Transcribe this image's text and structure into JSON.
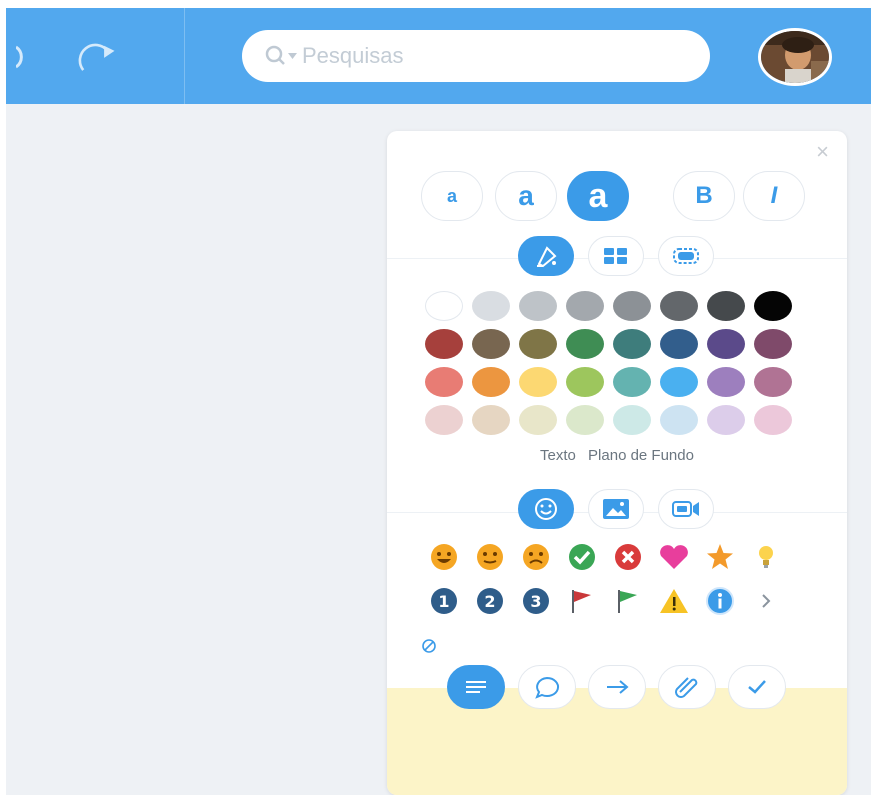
{
  "toolbar": {
    "undo_icon": "undo-icon",
    "redo_icon": "redo-icon",
    "search_placeholder": "Pesquisas",
    "avatar_icon": "avatar"
  },
  "panel": {
    "close_label": "×",
    "font_buttons": [
      {
        "label": "a",
        "name": "font-size-small-button"
      },
      {
        "label": "a",
        "name": "font-size-medium-button"
      },
      {
        "label": "a",
        "name": "font-size-large-button",
        "active": true
      },
      {
        "label": "B",
        "name": "bold-button"
      },
      {
        "label": "I",
        "name": "italic-button"
      }
    ],
    "color_tabs": [
      "fill-icon",
      "layout-icon",
      "border-icon"
    ],
    "colors": [
      [
        "#ffffff",
        "#d9dde2",
        "#bec3c8",
        "#a3a8ad",
        "#8c9196",
        "#63676b",
        "#45494c",
        "#050505"
      ],
      [
        "#a6403c",
        "#786650",
        "#7f7547",
        "#3f8d54",
        "#3e7d7c",
        "#325e8c",
        "#5b4a8a",
        "#7f4a6a"
      ],
      [
        "#e87c74",
        "#ec9640",
        "#fcd872",
        "#9dc65d",
        "#64b3b0",
        "#4ab0f0",
        "#9d7fbe",
        "#b07394"
      ],
      [
        "#ecd1d1",
        "#e6d6c2",
        "#e8e6c9",
        "#dbe8cb",
        "#cde9e7",
        "#cde3f2",
        "#dccdea",
        "#ecc8da"
      ]
    ],
    "color_labels": {
      "text": "Texto",
      "background": "Plano de Fundo"
    },
    "icon_tabs": [
      "smiley-icon",
      "image-icon",
      "video-icon"
    ],
    "icon_rows": [
      [
        "smiley-happy-icon",
        "smiley-neutral-icon",
        "smiley-sad-icon",
        "check-icon",
        "cross-icon",
        "heart-icon",
        "star-icon",
        "bulb-icon"
      ],
      [
        "number-1-icon",
        "number-2-icon",
        "number-3-icon",
        "red-flag-icon",
        "green-flag-icon",
        "warning-icon",
        "info-icon",
        "chevron-right-icon"
      ]
    ],
    "number_labels": [
      "1",
      "2",
      "3"
    ],
    "shape_buttons": [
      "text-lines-icon",
      "speech-bubble-icon",
      "arrow-right-icon",
      "attachment-icon",
      "checkmark-icon"
    ],
    "accent_color": "#3b9be8",
    "note_color": "#fcf4c8"
  }
}
